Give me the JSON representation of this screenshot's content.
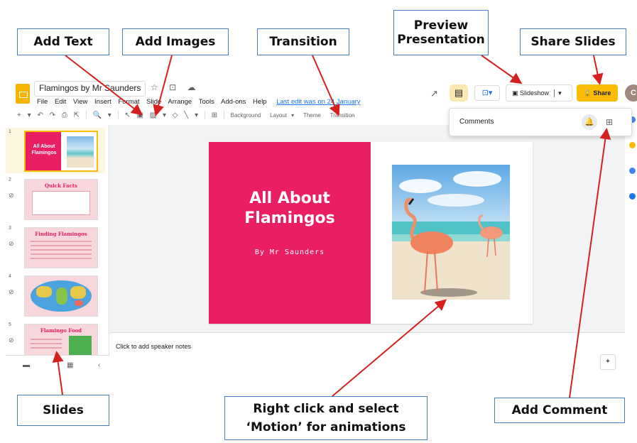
{
  "doc": {
    "title": "Flamingos by Mr Saunders",
    "title_icons": "☆ ⊡ ☁",
    "menus": [
      "File",
      "Edit",
      "View",
      "Insert",
      "Format",
      "Slide",
      "Arrange",
      "Tools",
      "Add-ons",
      "Help"
    ],
    "last_edit": "Last edit was on 24 January"
  },
  "header": {
    "trend_icon": "↗",
    "comment_icon": "▤",
    "meet_icon": "⊡▾",
    "slideshow_label": "Slideshow",
    "share_label": "Share",
    "avatar_letter": "C"
  },
  "toolbar": {
    "icons": [
      "+",
      "▾",
      "↶",
      "↷",
      "⎙",
      "⇱",
      "🔍",
      "▾",
      "↖",
      "▣",
      "▨",
      "▾",
      "◇",
      "╲",
      "▾",
      "⊞"
    ],
    "background": "Background",
    "layout": "Layout",
    "theme": "Theme",
    "transition": "Transition"
  },
  "comments_panel": {
    "label": "Comments",
    "bell_icon": "🔔",
    "add_icon": "⊞"
  },
  "slides": [
    {
      "number": "1",
      "title": "All About Flamingos"
    },
    {
      "number": "2",
      "title": "Quick Facts"
    },
    {
      "number": "3",
      "title": "Finding Flamingos"
    },
    {
      "number": "4",
      "title": ""
    },
    {
      "number": "5",
      "title": "Flamingo Food"
    }
  ],
  "current_slide": {
    "title_line1": "All About",
    "title_line2": "Flamingos",
    "subtitle": "By Mr Saunders"
  },
  "notes_placeholder": "Click to add speaker notes",
  "callouts": {
    "add_text": "Add Text",
    "add_images": "Add Images",
    "transition": "Transition",
    "preview_line1": "Preview",
    "preview_line2": "Presentation",
    "share_slides": "Share Slides",
    "slides": "Slides",
    "motion_line1": "Right click and select",
    "motion_line2": "‘Motion’ for animations",
    "add_comment": "Add Comment"
  },
  "colors": {
    "accent_pink": "#e91e63",
    "share_yellow": "#fbbc04",
    "callout_border": "#4a7ebb",
    "arrow_red": "#d62020"
  }
}
